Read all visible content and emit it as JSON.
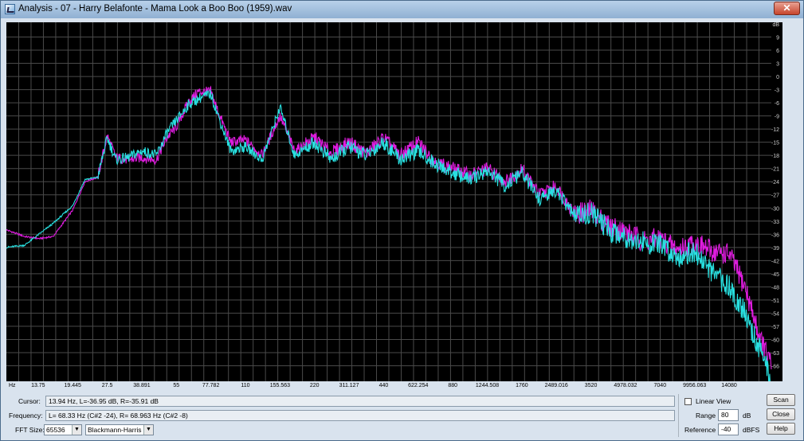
{
  "window": {
    "title": "Analysis - 07 - Harry Belafonte - Mama Look a Boo Boo (1959).wav"
  },
  "colors": {
    "left_channel": "#e01ce0",
    "right_channel": "#28e0e0",
    "grid": "#4a4a4a",
    "background": "#000000"
  },
  "chart_data": {
    "type": "line",
    "x_scale": "log",
    "xlabel": "Hz",
    "x_ticks": [
      "13.75",
      "19.445",
      "27.5",
      "38.891",
      "55",
      "77.782",
      "110",
      "155.563",
      "220",
      "311.127",
      "440",
      "622.254",
      "880",
      "1244.508",
      "1760",
      "2489.016",
      "3520",
      "4978.032",
      "7040",
      "9956.063",
      "14080"
    ],
    "y_ticks": [
      "dB",
      "9",
      "6",
      "3",
      "0",
      "-3",
      "-6",
      "-9",
      "-12",
      "-15",
      "-18",
      "-21",
      "-24",
      "-27",
      "-30",
      "-33",
      "-36",
      "-39",
      "-42",
      "-45",
      "-48",
      "-51",
      "-54",
      "-57",
      "-60",
      "-63",
      "-66"
    ],
    "ylim": [
      -69,
      12
    ],
    "grid": true,
    "series": [
      {
        "name": "L",
        "color": "#e01ce0",
        "x": [
          10,
          12,
          13.94,
          16,
          19.445,
          22,
          25,
          27.5,
          30,
          34,
          38.891,
          45,
          50,
          55,
          62,
          68.33,
          77.782,
          85,
          95,
          110,
          130,
          155.563,
          180,
          220,
          260,
          311.127,
          370,
          440,
          520,
          622.254,
          740,
          880,
          1050,
          1244.508,
          1500,
          1760,
          2100,
          2489.016,
          3000,
          3520,
          4200,
          4978.032,
          6000,
          7040,
          8400,
          9956.063,
          12000,
          14080,
          16500,
          19000,
          21500
        ],
        "y": [
          -35,
          -36.5,
          -37,
          -36.5,
          -30.5,
          -24,
          -23,
          -13.5,
          -18.5,
          -19,
          -18.5,
          -19,
          -14,
          -11.5,
          -6,
          -3.5,
          -3.5,
          -9,
          -15,
          -14.5,
          -18,
          -9,
          -17,
          -14,
          -17.5,
          -15,
          -17.5,
          -14,
          -18,
          -15,
          -19.5,
          -21,
          -22.5,
          -21,
          -24,
          -21,
          -27,
          -25,
          -31.5,
          -30.5,
          -34,
          -35.5,
          -37.5,
          -37,
          -39.5,
          -38,
          -40,
          -40.5,
          -48,
          -59,
          -66
        ]
      },
      {
        "name": "R",
        "color": "#28e0e0",
        "x": [
          10,
          12,
          13.94,
          16,
          19.445,
          22,
          25,
          27.5,
          30,
          34,
          38.891,
          45,
          50,
          55,
          62,
          68.963,
          77.782,
          85,
          95,
          110,
          130,
          155.563,
          180,
          220,
          260,
          311.127,
          370,
          440,
          520,
          622.254,
          740,
          880,
          1050,
          1244.508,
          1500,
          1760,
          2100,
          2489.016,
          3000,
          3520,
          4200,
          4978.032,
          6000,
          7040,
          8400,
          9956.063,
          12000,
          14080,
          16500,
          19000,
          21500
        ],
        "y": [
          -39,
          -38.5,
          -35.9,
          -33.5,
          -29.5,
          -23.5,
          -23,
          -14,
          -19,
          -18.5,
          -17,
          -18,
          -13,
          -10,
          -6.5,
          -5,
          -4,
          -10,
          -17,
          -16,
          -19,
          -7,
          -18,
          -15,
          -19,
          -16,
          -18,
          -15,
          -19,
          -17,
          -20,
          -22,
          -23.5,
          -21.5,
          -25,
          -22,
          -28,
          -26,
          -32,
          -31,
          -35,
          -36.5,
          -38,
          -38.5,
          -41,
          -40,
          -45,
          -48,
          -54,
          -62,
          -69
        ]
      }
    ]
  },
  "status": {
    "cursor_label": "Cursor:",
    "cursor_value": "13.94 Hz, L=-36.95 dB, R=-35.91 dB",
    "frequency_label": "Frequency:",
    "frequency_value": "L= 68.33 Hz (C#2 -24), R= 68.963 Hz (C#2 -8)",
    "fft_label": "FFT Size:",
    "fft_value": "65536",
    "window_value": "Blackmann-Harris"
  },
  "options": {
    "linear_view": "Linear View",
    "range_label": "Range",
    "range_value": "80",
    "range_unit": "dB",
    "reference_label": "Reference",
    "reference_value": "-40",
    "reference_unit": "dBFS"
  },
  "buttons": {
    "scan": "Scan",
    "close": "Close",
    "help": "Help"
  }
}
